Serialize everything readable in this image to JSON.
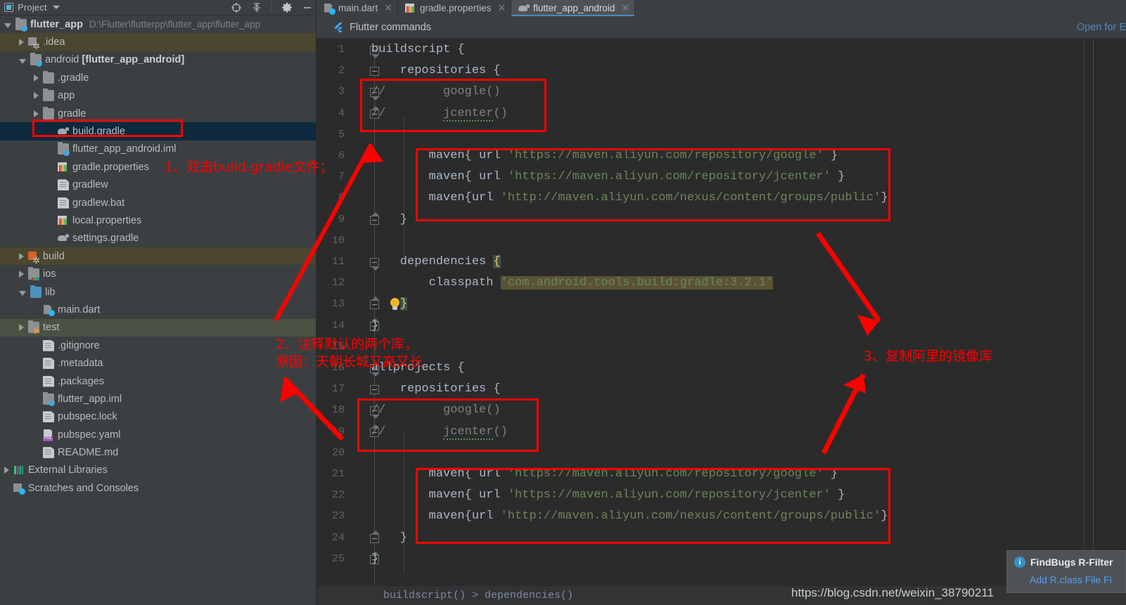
{
  "panel": {
    "title": "Project",
    "icons": [
      "project-icon",
      "chevron-down-icon",
      "locate-icon",
      "collapse-all-icon",
      "gear-icon",
      "minimize-icon"
    ]
  },
  "tree": [
    {
      "label": "flutter_app",
      "path": "D:\\Flutter\\flutterpp\\flutter_app\\flutter_app",
      "icon": "module-folder-icon",
      "arrow": "open",
      "indent": 0,
      "bold": true,
      "state": "normal"
    },
    {
      "label": ".idea",
      "path": "",
      "icon": "idea-folder-icon",
      "arrow": "closed",
      "indent": 1,
      "bold": false,
      "state": "olive"
    },
    {
      "label": "android ",
      "suffix": "[flutter_app_android]",
      "path": "",
      "icon": "module-folder-icon",
      "arrow": "open",
      "indent": 1,
      "bold": false,
      "state": "normal"
    },
    {
      "label": ".gradle",
      "path": "",
      "icon": "folder-icon",
      "arrow": "closed",
      "indent": 2,
      "bold": false,
      "state": "normal"
    },
    {
      "label": "app",
      "path": "",
      "icon": "folder-icon",
      "arrow": "closed",
      "indent": 2,
      "bold": false,
      "state": "normal"
    },
    {
      "label": "gradle",
      "path": "",
      "icon": "folder-icon",
      "arrow": "closed",
      "indent": 2,
      "bold": false,
      "state": "normal"
    },
    {
      "label": "build.gradle",
      "path": "",
      "icon": "gradle-file-icon",
      "arrow": "none",
      "indent": 3,
      "bold": false,
      "state": "blue"
    },
    {
      "label": "flutter_app_android.iml",
      "path": "",
      "icon": "module-folder-icon",
      "arrow": "none",
      "indent": 3,
      "bold": false,
      "state": "normal"
    },
    {
      "label": "gradle.properties",
      "path": "",
      "icon": "properties-file-icon",
      "arrow": "none",
      "indent": 3,
      "bold": false,
      "state": "normal"
    },
    {
      "label": "gradlew",
      "path": "",
      "icon": "text-file-icon",
      "arrow": "none",
      "indent": 3,
      "bold": false,
      "state": "normal"
    },
    {
      "label": "gradlew.bat",
      "path": "",
      "icon": "text-file-icon",
      "arrow": "none",
      "indent": 3,
      "bold": false,
      "state": "normal"
    },
    {
      "label": "local.properties",
      "path": "",
      "icon": "properties-file-icon",
      "arrow": "none",
      "indent": 3,
      "bold": false,
      "state": "normal"
    },
    {
      "label": "settings.gradle",
      "path": "",
      "icon": "gradle-file-icon",
      "arrow": "none",
      "indent": 3,
      "bold": false,
      "state": "normal"
    },
    {
      "label": "build",
      "path": "",
      "icon": "build-folder-icon",
      "arrow": "closed",
      "indent": 1,
      "bold": false,
      "state": "olive"
    },
    {
      "label": "ios",
      "path": "",
      "icon": "ios-folder-icon",
      "arrow": "closed",
      "indent": 1,
      "bold": false,
      "state": "normal"
    },
    {
      "label": "lib",
      "path": "",
      "icon": "folder-blue-icon",
      "arrow": "open",
      "indent": 1,
      "bold": false,
      "state": "normal"
    },
    {
      "label": "main.dart",
      "path": "",
      "icon": "dart-file-icon",
      "arrow": "none",
      "indent": 2,
      "bold": false,
      "state": "normal"
    },
    {
      "label": "test",
      "path": "",
      "icon": "test-folder-icon",
      "arrow": "closed",
      "indent": 1,
      "bold": false,
      "state": "green"
    },
    {
      "label": ".gitignore",
      "path": "",
      "icon": "text-file-icon",
      "arrow": "none",
      "indent": 2,
      "bold": false,
      "state": "normal"
    },
    {
      "label": ".metadata",
      "path": "",
      "icon": "text-file-icon",
      "arrow": "none",
      "indent": 2,
      "bold": false,
      "state": "normal"
    },
    {
      "label": ".packages",
      "path": "",
      "icon": "text-file-icon",
      "arrow": "none",
      "indent": 2,
      "bold": false,
      "state": "normal"
    },
    {
      "label": "flutter_app.iml",
      "path": "",
      "icon": "module-folder-icon",
      "arrow": "none",
      "indent": 2,
      "bold": false,
      "state": "normal"
    },
    {
      "label": "pubspec.lock",
      "path": "",
      "icon": "text-file-icon",
      "arrow": "none",
      "indent": 2,
      "bold": false,
      "state": "normal"
    },
    {
      "label": "pubspec.yaml",
      "path": "",
      "icon": "yaml-file-icon",
      "arrow": "none",
      "indent": 2,
      "bold": false,
      "state": "normal"
    },
    {
      "label": "README.md",
      "path": "",
      "icon": "text-file-icon",
      "arrow": "none",
      "indent": 2,
      "bold": false,
      "state": "normal"
    },
    {
      "label": "External Libraries",
      "path": "",
      "icon": "external-libraries-icon",
      "arrow": "closed",
      "indent": 0,
      "bold": false,
      "state": "normal"
    },
    {
      "label": "Scratches and Consoles",
      "path": "",
      "icon": "scratches-icon",
      "arrow": "none",
      "indent": 0,
      "bold": false,
      "state": "normal"
    }
  ],
  "tabs": [
    {
      "label": "main.dart",
      "icon": "dart-file-icon",
      "active": false
    },
    {
      "label": "gradle.properties",
      "icon": "properties-file-icon",
      "active": false
    },
    {
      "label": "flutter_app_android",
      "icon": "gradle-file-icon",
      "active": true
    }
  ],
  "command_bar": {
    "label": "Flutter commands",
    "icon": "flutter-icon",
    "open_link": "Open for E"
  },
  "editor": {
    "lines": [
      {
        "n": "1",
        "text": "buildscript {"
      },
      {
        "n": "2",
        "text": "    repositories {"
      },
      {
        "n": "3",
        "text": "//        google()"
      },
      {
        "n": "4",
        "text": "//        jcenter()"
      },
      {
        "n": "5",
        "text": ""
      },
      {
        "n": "6",
        "text": "        maven{ url 'https://maven.aliyun.com/repository/google' }"
      },
      {
        "n": "7",
        "text": "        maven{ url 'https://maven.aliyun.com/repository/jcenter' }"
      },
      {
        "n": "8",
        "text": "        maven{url 'http://maven.aliyun.com/nexus/content/groups/public'}"
      },
      {
        "n": "9",
        "text": "    }"
      },
      {
        "n": "10",
        "text": ""
      },
      {
        "n": "11",
        "text": "    dependencies {"
      },
      {
        "n": "12",
        "text": "        classpath 'com.android.tools.build:gradle:3.2.1'"
      },
      {
        "n": "13",
        "text": "    }"
      },
      {
        "n": "14",
        "text": "}"
      },
      {
        "n": "15",
        "text": ""
      },
      {
        "n": "16",
        "text": "allprojects {"
      },
      {
        "n": "17",
        "text": "    repositories {"
      },
      {
        "n": "18",
        "text": "//        google()"
      },
      {
        "n": "19",
        "text": "//        jcenter()"
      },
      {
        "n": "20",
        "text": ""
      },
      {
        "n": "21",
        "text": "        maven{ url 'https://maven.aliyun.com/repository/google' }"
      },
      {
        "n": "22",
        "text": "        maven{ url 'https://maven.aliyun.com/repository/jcenter' }"
      },
      {
        "n": "23",
        "text": "        maven{url 'http://maven.aliyun.com/nexus/content/groups/public'}"
      },
      {
        "n": "24",
        "text": "    }"
      },
      {
        "n": "25",
        "text": "}"
      }
    ],
    "breadcrumb": "buildscript() > dependencies()"
  },
  "annotations": [
    {
      "id": "step1",
      "text": "1、双击bulid.gradle文件；"
    },
    {
      "id": "step2",
      "text": "2、注释默认的两个库，\n原因：天朝长城又高又长"
    },
    {
      "id": "step3",
      "text": "3、复制阿里的镜像库"
    }
  ],
  "notification": {
    "title": "FindBugs R-Filter",
    "link": "Add R.class File Fi",
    "icon": "info-icon"
  },
  "watermark": "https://blog.csdn.net/weixin_38790211",
  "colors": {
    "annotation_red": "#ff0000",
    "accent_blue": "#4a88c7",
    "string_green": "#6a8759",
    "comment_gray": "#808080",
    "editor_bg": "#2b2b2b",
    "panel_bg": "#3c3f41"
  }
}
